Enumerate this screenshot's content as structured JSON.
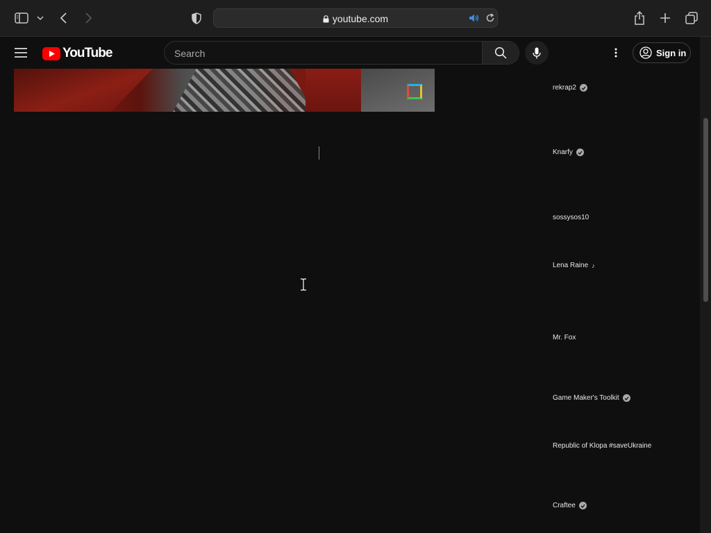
{
  "browser": {
    "url": "youtube.com"
  },
  "header": {
    "logo_text": "YouTube",
    "search_placeholder": "Search",
    "signin_label": "Sign in"
  },
  "channels": [
    {
      "name": "rekrap2",
      "badge": "verified"
    },
    {
      "name": "Knarfy",
      "badge": "verified"
    },
    {
      "name": "sossysos10",
      "badge": "none"
    },
    {
      "name": "Lena Raine",
      "badge": "music-note"
    },
    {
      "name": "Mr. Fox",
      "badge": "none"
    },
    {
      "name": "Game Maker's Toolkit",
      "badge": "verified"
    },
    {
      "name": "Republic of Klopa #saveUkraine",
      "badge": "none"
    },
    {
      "name": "Craftee",
      "badge": "verified"
    }
  ],
  "colors": {
    "background": "#0f0f0f",
    "youtube_red": "#ff0000",
    "audio_blue": "#3a8ee6"
  }
}
